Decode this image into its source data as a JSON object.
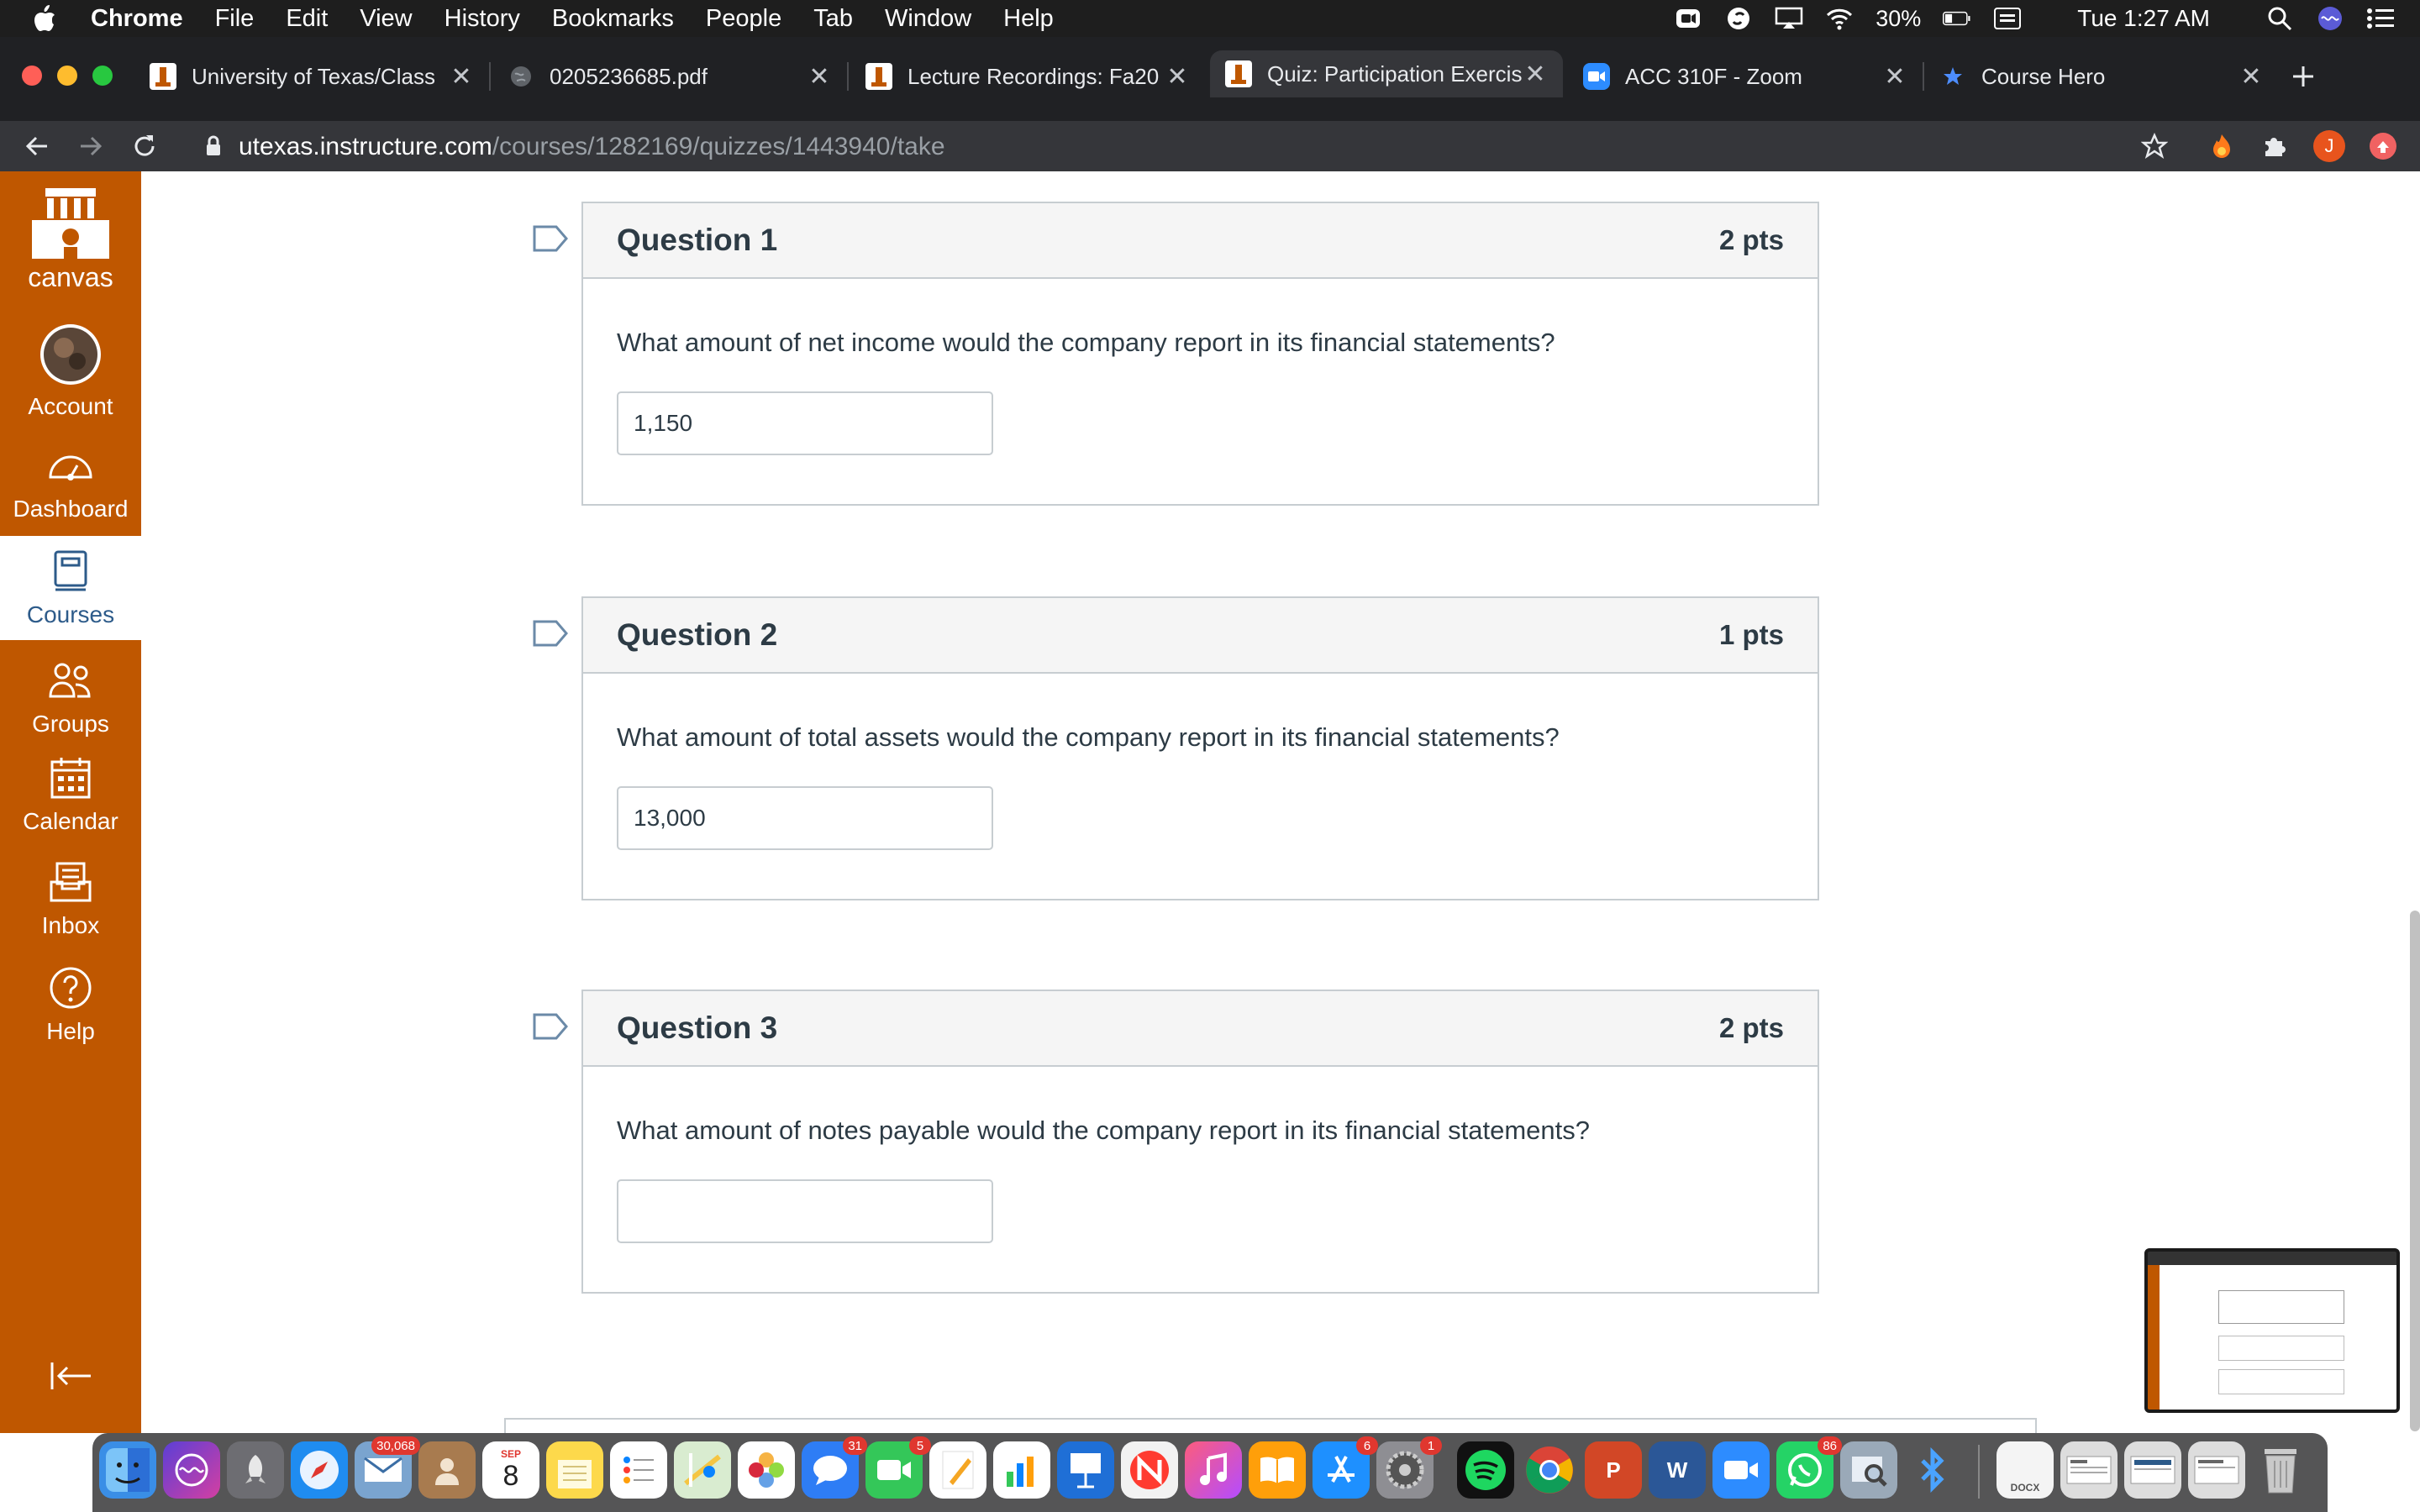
{
  "menubar": {
    "app": "Chrome",
    "items": [
      "File",
      "Edit",
      "View",
      "History",
      "Bookmarks",
      "People",
      "Tab",
      "Window",
      "Help"
    ],
    "battery": "30%",
    "clock": "Tue 1:27 AM"
  },
  "tabs": [
    {
      "title": "University of Texas/Class",
      "icon": "ut-tower-icon"
    },
    {
      "title": "0205236685.pdf",
      "icon": "globe-icon"
    },
    {
      "title": "Lecture Recordings: Fa20",
      "icon": "ut-tower-icon"
    },
    {
      "title": "Quiz: Participation Exercis",
      "icon": "ut-tower-icon"
    },
    {
      "title": "ACC 310F - Zoom",
      "icon": "zoom-icon"
    },
    {
      "title": "Course Hero",
      "icon": "star-icon"
    }
  ],
  "address": {
    "host": "utexas.instructure.com",
    "path": "/courses/1282169/quizzes/1443940/take"
  },
  "profile_initial": "J",
  "sidebar": {
    "logo_label": "canvas",
    "items": [
      {
        "label": "Account",
        "icon": "avatar-icon"
      },
      {
        "label": "Dashboard",
        "icon": "dashboard-icon"
      },
      {
        "label": "Courses",
        "icon": "courses-icon"
      },
      {
        "label": "Groups",
        "icon": "groups-icon"
      },
      {
        "label": "Calendar",
        "icon": "calendar-icon"
      },
      {
        "label": "Inbox",
        "icon": "inbox-icon"
      },
      {
        "label": "Help",
        "icon": "help-icon"
      }
    ]
  },
  "questions": [
    {
      "title": "Question 1",
      "points": "2 pts",
      "text": "What amount of net income would the company report in its financial statements?",
      "answer": "1,150"
    },
    {
      "title": "Question 2",
      "points": "1 pts",
      "text": "What amount of total assets would the company report in its financial statements?",
      "answer": "13,000"
    },
    {
      "title": "Question 3",
      "points": "2 pts",
      "text": "What amount of notes payable would the company report in its financial statements?",
      "answer": ""
    }
  ],
  "dock": {
    "mail_badge": "30,068",
    "calendar_month": "SEP",
    "calendar_day": "8",
    "messages_badge": "31",
    "facetime_badge": "5",
    "appstore_badge": "6",
    "settings_badge": "1",
    "whatsapp_badge": "86",
    "doc_label": "DOCX"
  }
}
